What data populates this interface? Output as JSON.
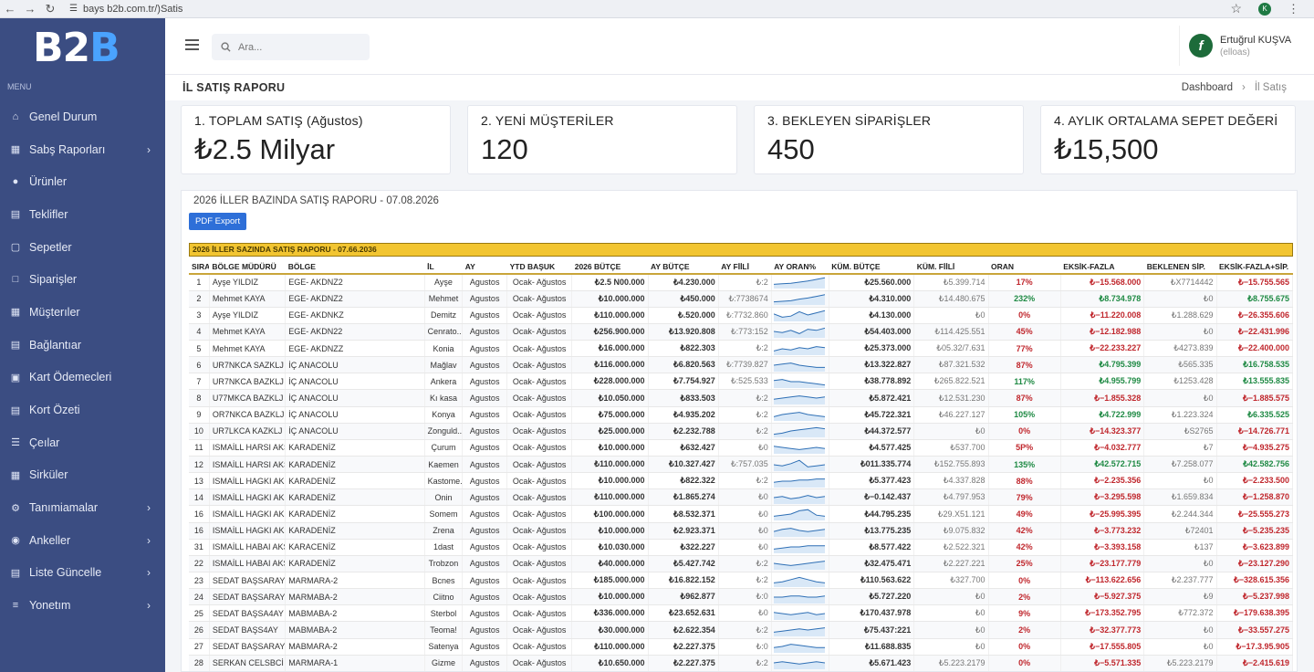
{
  "browser": {
    "url": "bays b2b.com.tr/)Satis"
  },
  "sidebar": {
    "logo_a": "B2",
    "logo_b": "B",
    "menu_label": "MENU",
    "items": [
      {
        "label": "Genel Durum",
        "icon": "home-icon",
        "chevron": false
      },
      {
        "label": "Sabş Raporları",
        "icon": "chart-icon",
        "chevron": true
      },
      {
        "label": "Ürünler",
        "icon": "box-icon",
        "chevron": false
      },
      {
        "label": "Teklifler",
        "icon": "document-icon",
        "chevron": false
      },
      {
        "label": "Sepetler",
        "icon": "cart-icon",
        "chevron": false
      },
      {
        "label": "Siparişler",
        "icon": "order-icon",
        "chevron": false
      },
      {
        "label": "Müşterıler",
        "icon": "users-icon",
        "chevron": false
      },
      {
        "label": "Bağlantıar",
        "icon": "link-icon",
        "chevron": false
      },
      {
        "label": "Kart Ödemecleri",
        "icon": "card-icon",
        "chevron": false
      },
      {
        "label": "Kort Özeti",
        "icon": "summary-icon",
        "chevron": false
      },
      {
        "label": "Çeılar",
        "icon": "cheque-icon",
        "chevron": false
      },
      {
        "label": "Sirküler",
        "icon": "circular-icon",
        "chevron": false
      },
      {
        "label": "Tanımiamalar",
        "icon": "settings-icon",
        "chevron": true
      },
      {
        "label": "Ankeller",
        "icon": "survey-icon",
        "chevron": true
      },
      {
        "label": "Liste Güncelle",
        "icon": "list-icon",
        "chevron": true
      },
      {
        "label": "Yonetım",
        "icon": "admin-icon",
        "chevron": true
      }
    ]
  },
  "header": {
    "search_placeholder": "Ara...",
    "user_initial": "f",
    "user_name": "Ertuğrul KUŞVA",
    "user_role": "(elloas)"
  },
  "page": {
    "title": "İL SATIŞ RAPORU",
    "breadcrumb_home": "Dashboard",
    "breadcrumb_sep": "›",
    "breadcrumb_current": "İl Satış"
  },
  "cards": [
    {
      "label": "1. TOPLAM SATIŞ (Ağustos)",
      "value": "₺2.5 Milyar"
    },
    {
      "label": "2. YENİ MÜŞTERİLER",
      "value": "120"
    },
    {
      "label": "3. BEKLEYEN SİPARİŞLER",
      "value": "450"
    },
    {
      "label": "4. AYLIK ORTALAMA SEPET DEĞERİ",
      "value": "₺15,500"
    }
  ],
  "report": {
    "title": "2026 İLLER BAZINDA SATIŞ RAPORU - 07.08.2026",
    "pdf_button": "PDF Export",
    "banner": "2026 İLLER SAZINDA SATIŞ RAPORU - 07.66.2036",
    "columns": [
      "SIRA",
      "BÖLGE MÜDÜRÜ",
      "BÖLGE",
      "İL",
      "AY",
      "YTD BAŞUK",
      "2026 BÜTÇE",
      "AY BÜTÇE",
      "AY FİİLİ",
      "AY ORAN%",
      "KÜM. BÜTÇE",
      "KÜM. FİİLİ",
      "ORAN",
      "EKSİK-FAZLA",
      "BEKLENEN SİP.",
      "EKSİK-FAZLA+SİP."
    ],
    "rows": [
      {
        "sira": "1",
        "mudur": "Ayşe YILDIZ",
        "bolge": "EGE- AKDNZ2",
        "il": "Ayşe",
        "ay": "Agustos",
        "ytd": "Ocak- Ağustos",
        "butce": "₺2.5 N00.000",
        "ay_butce": "₺4.230.000",
        "ay_fiili": "₺:2",
        "trend": [
          0.3,
          0.35,
          0.4,
          0.5,
          0.6,
          0.75,
          0.9
        ],
        "kum_butce": "₺25.560.000",
        "kum_fiili": "₺5.399.714",
        "oran": "17%",
        "oran_pos": false,
        "eksik": "₺−15.568.000",
        "eksik_pos": false,
        "beklenen": "₺X7714442",
        "son": "₺−15.755.565",
        "son_pos": false
      },
      {
        "sira": "2",
        "mudur": "Mehmet KAYA",
        "bolge": "EGE- AKDNZ2",
        "il": "Mehmet",
        "ay": "Agustos",
        "ytd": "Ocak- Ağustos",
        "butce": "₺10.000.000",
        "ay_butce": "₺450.000",
        "ay_fiili": "₺:7738674",
        "trend": [
          0.2,
          0.25,
          0.3,
          0.45,
          0.55,
          0.7,
          0.85
        ],
        "kum_butce": "₺4.310.000",
        "kum_fiili": "₺14.480.675",
        "oran": "232%",
        "oran_pos": true,
        "eksik": "₺8.734.978",
        "eksik_pos": true,
        "beklenen": "₺0",
        "son": "₺8.755.675",
        "son_pos": true
      },
      {
        "sira": "3",
        "mudur": "Ayşe YILDIZ",
        "bolge": "EGE- AKDNKZ",
        "il": "Demitz",
        "ay": "Agustos",
        "ytd": "Ocak- Ağustos",
        "butce": "₺110.000.000",
        "ay_butce": "₺.520.000",
        "ay_fiili": "₺:7732.860",
        "trend": [
          0.6,
          0.3,
          0.4,
          0.8,
          0.5,
          0.7,
          0.9
        ],
        "kum_butce": "₺4.130.000",
        "kum_fiili": "₺0",
        "oran": "0%",
        "oran_pos": false,
        "eksik": "₺−11.220.008",
        "eksik_pos": false,
        "beklenen": "₺1.288.629",
        "son": "₺−26.355.606",
        "son_pos": false
      },
      {
        "sira": "4",
        "mudur": "Mehmet KAYA",
        "bolge": "EGE- AKDN22",
        "il": "Cenrato...",
        "ay": "Agustos",
        "ytd": "Ocak- Ağustos",
        "butce": "₺256.900.000",
        "ay_butce": "₺13.920.808",
        "ay_fiili": "₺:773:152",
        "trend": [
          0.5,
          0.4,
          0.6,
          0.3,
          0.7,
          0.6,
          0.8
        ],
        "kum_butce": "₺54.403.000",
        "kum_fiili": "₺114.425.551",
        "oran": "45%",
        "oran_pos": false,
        "eksik": "₺−12.182.988",
        "eksik_pos": false,
        "beklenen": "₺0",
        "son": "₺−22.431.996",
        "son_pos": false
      },
      {
        "sira": "5",
        "mudur": "Mehmet KAYA",
        "bolge": "EGE- AKDNZZ",
        "il": "Konia",
        "ay": "Agustos",
        "ytd": "Ocak- Ağustos",
        "butce": "₺16.000.000",
        "ay_butce": "₺822.303",
        "ay_fiili": "₺:2",
        "trend": [
          0.3,
          0.5,
          0.4,
          0.6,
          0.5,
          0.7,
          0.6
        ],
        "kum_butce": "₺25.373.000",
        "kum_fiili": "₺05.32/7.631",
        "oran": "77%",
        "oran_pos": false,
        "eksik": "₺−22.233.227",
        "eksik_pos": false,
        "beklenen": "₺4273.839",
        "son": "₺−22.400.000",
        "son_pos": false
      },
      {
        "sira": "6",
        "mudur": "UR7NKCA SAZKLJ",
        "bolge": "İÇ ANACOLU",
        "il": "Mağlav",
        "ay": "Agustos",
        "ytd": "Ocak- Ağustos",
        "butce": "₺116.000.000",
        "ay_butce": "₺6.820.563",
        "ay_fiili": "₺:7739.827",
        "trend": [
          0.5,
          0.6,
          0.7,
          0.5,
          0.4,
          0.3,
          0.3
        ],
        "kum_butce": "₺13.322.827",
        "kum_fiili": "₺87.321.532",
        "oran": "87%",
        "oran_pos": false,
        "eksik": "₺4.795.399",
        "eksik_pos": true,
        "beklenen": "₺565.335",
        "son": "₺16.758.535",
        "son_pos": true
      },
      {
        "sira": "7",
        "mudur": "UR7NKCA BAZKLJ",
        "bolge": "İÇ ANACOLU",
        "il": "Ankera",
        "ay": "Agustos",
        "ytd": "Ocak- Ağustos",
        "butce": "₺228.000.000",
        "ay_butce": "₺7.754.927",
        "ay_fiili": "₺:525.533",
        "trend": [
          0.6,
          0.7,
          0.5,
          0.5,
          0.4,
          0.3,
          0.2
        ],
        "kum_butce": "₺38.778.892",
        "kum_fiili": "₺265.822.521",
        "oran": "117%",
        "oran_pos": true,
        "eksik": "₺4.955.799",
        "eksik_pos": true,
        "beklenen": "₺1253.428",
        "son": "₺13.555.835",
        "son_pos": true
      },
      {
        "sira": "8",
        "mudur": "U77MKCA BAZKLJ",
        "bolge": "İÇ ANACOLU",
        "il": "Kı kasa",
        "ay": "Agustos",
        "ytd": "Ocak- Ağustos",
        "butce": "₺10.050.000",
        "ay_butce": "₺833.503",
        "ay_fiili": "₺:2",
        "trend": [
          0.4,
          0.5,
          0.6,
          0.7,
          0.6,
          0.5,
          0.6
        ],
        "kum_butce": "₺5.872.421",
        "kum_fiili": "₺12.531.230",
        "oran": "87%",
        "oran_pos": false,
        "eksik": "₺−1.855.328",
        "eksik_pos": false,
        "beklenen": "₺0",
        "son": "₺−1.885.575",
        "son_pos": false
      },
      {
        "sira": "9",
        "mudur": "OR7NKCA BAZKLJ",
        "bolge": "İÇ ANACOLU",
        "il": "Konya",
        "ay": "Agustos",
        "ytd": "Ocak- Ağustos",
        "butce": "₺75.000.000",
        "ay_butce": "₺4.935.202",
        "ay_fiili": "₺:2",
        "trend": [
          0.3,
          0.5,
          0.6,
          0.7,
          0.5,
          0.4,
          0.3
        ],
        "kum_butce": "₺45.722.321",
        "kum_fiili": "₺46.227.127",
        "oran": "105%",
        "oran_pos": true,
        "eksik": "₺4.722.999",
        "eksik_pos": true,
        "beklenen": "₺1.223.324",
        "son": "₺6.335.525",
        "son_pos": true
      },
      {
        "sira": "10",
        "mudur": "UR7LKCA KAZKLJ",
        "bolge": "İÇ ANACOLU",
        "il": "Zonguld...",
        "ay": "Agustos",
        "ytd": "Ocak- Ağustos",
        "butce": "₺25.000.000",
        "ay_butce": "₺2.232.788",
        "ay_fiili": "₺:2",
        "trend": [
          0.2,
          0.3,
          0.5,
          0.6,
          0.7,
          0.8,
          0.7
        ],
        "kum_butce": "₺44.372.577",
        "kum_fiili": "₺0",
        "oran": "0%",
        "oran_pos": false,
        "eksik": "₺−14.323.377",
        "eksik_pos": false,
        "beklenen": "₺S2765",
        "son": "₺−14.726.771",
        "son_pos": false
      },
      {
        "sira": "11",
        "mudur": "ISMAİLL HARSI AKS.",
        "bolge": "KARADENİZ",
        "il": "Çurum",
        "ay": "Agustos",
        "ytd": "Ocak- Ağustos",
        "butce": "₺10.000.000",
        "ay_butce": "₺632.427",
        "ay_fiili": "₺0",
        "trend": [
          0.6,
          0.5,
          0.4,
          0.3,
          0.4,
          0.5,
          0.4
        ],
        "kum_butce": "₺4.577.425",
        "kum_fiili": "₺537.700",
        "oran": "5P%",
        "oran_pos": false,
        "eksik": "₺−4.032.777",
        "eksik_pos": false,
        "beklenen": "₺7",
        "son": "₺−4.935.275",
        "son_pos": false
      },
      {
        "sira": "12",
        "mudur": "ISMAİLL HARSI AKS.",
        "bolge": "KARADENİZ",
        "il": "Kaemen",
        "ay": "Agustos",
        "ytd": "Ocak- Ağustos",
        "butce": "₺110.000.000",
        "ay_butce": "₺10.327.427",
        "ay_fiili": "₺:757.035",
        "trend": [
          0.5,
          0.4,
          0.6,
          0.9,
          0.3,
          0.4,
          0.5
        ],
        "kum_butce": "₺011.335.774",
        "kum_fiili": "₺152.755.893",
        "oran": "135%",
        "oran_pos": true,
        "eksik": "₺42.572.715",
        "eksik_pos": true,
        "beklenen": "₺7.258.077",
        "son": "₺42.582.756",
        "son_pos": true
      },
      {
        "sira": "13",
        "mudur": "ISMAİLL HAGKI AKS.",
        "bolge": "KARADENİZ",
        "il": "Kastome...",
        "ay": "Agustos",
        "ytd": "Ocak- Ağustos",
        "butce": "₺10.000.000",
        "ay_butce": "₺822.322",
        "ay_fiili": "₺:2",
        "trend": [
          0.4,
          0.5,
          0.5,
          0.6,
          0.6,
          0.7,
          0.7
        ],
        "kum_butce": "₺5.377.423",
        "kum_fiili": "₺4.337.828",
        "oran": "88%",
        "oran_pos": false,
        "eksik": "₺−2.235.356",
        "eksik_pos": false,
        "beklenen": "₺0",
        "son": "₺−2.233.500",
        "son_pos": false
      },
      {
        "sira": "14",
        "mudur": "ISMAİLL HAGKI AKS.",
        "bolge": "KARADENİZ",
        "il": "Onin",
        "ay": "Agustos",
        "ytd": "Ocak- Ağustos",
        "butce": "₺110.000.000",
        "ay_butce": "₺1.865.274",
        "ay_fiili": "₺0",
        "trend": [
          0.5,
          0.6,
          0.4,
          0.5,
          0.7,
          0.5,
          0.6
        ],
        "kum_butce": "₺−0.142.437",
        "kum_fiili": "₺4.797.953",
        "oran": "79%",
        "oran_pos": false,
        "eksik": "₺−3.295.598",
        "eksik_pos": false,
        "beklenen": "₺1.659.834",
        "son": "₺−1.258.870",
        "son_pos": false
      },
      {
        "sira": "16",
        "mudur": "ISMAİLL HAGKI AKS.",
        "bolge": "KARADENİZ",
        "il": "Somem",
        "ay": "Agustos",
        "ytd": "Ocak- Ağustos",
        "butce": "₺100.000.000",
        "ay_butce": "₺8.532.371",
        "ay_fiili": "₺0",
        "trend": [
          0.3,
          0.4,
          0.5,
          0.8,
          0.9,
          0.4,
          0.3
        ],
        "kum_butce": "₺44.795.235",
        "kum_fiili": "₺29.X51.121",
        "oran": "49%",
        "oran_pos": false,
        "eksik": "₺−25.995.395",
        "eksik_pos": false,
        "beklenen": "₺2.244.344",
        "son": "₺−25.555.273",
        "son_pos": false
      },
      {
        "sira": "16",
        "mudur": "ISMAİLL HAGKI AKS.",
        "bolge": "KARADENİZ",
        "il": "Zrena",
        "ay": "Agustos",
        "ytd": "Ocak- Ağustos",
        "butce": "₺10.000.000",
        "ay_butce": "₺2.923.371",
        "ay_fiili": "₺0",
        "trend": [
          0.4,
          0.6,
          0.7,
          0.5,
          0.4,
          0.5,
          0.6
        ],
        "kum_butce": "₺13.775.235",
        "kum_fiili": "₺9.075.832",
        "oran": "42%",
        "oran_pos": false,
        "eksik": "₺−3.773.232",
        "eksik_pos": false,
        "beklenen": "₺72401",
        "son": "₺−5.235.235",
        "son_pos": false
      },
      {
        "sira": "31",
        "mudur": "ISMAİLL HABAI AKS.",
        "bolge": "KARACENİZ",
        "il": "1dast",
        "ay": "Agustos",
        "ytd": "Ocak- Ağustos",
        "butce": "₺10.030.000",
        "ay_butce": "₺322.227",
        "ay_fiili": "₺0",
        "trend": [
          0.3,
          0.4,
          0.5,
          0.5,
          0.6,
          0.6,
          0.6
        ],
        "kum_butce": "₺8.577.422",
        "kum_fiili": "₺2.522.321",
        "oran": "42%",
        "oran_pos": false,
        "eksik": "₺−3.393.158",
        "eksik_pos": false,
        "beklenen": "₺137",
        "son": "₺−3.623.899",
        "son_pos": false
      },
      {
        "sira": "22",
        "mudur": "ISMAİLL HABAI AKS.",
        "bolge": "KARADENİZ",
        "il": "Trobzon",
        "ay": "Agustos",
        "ytd": "Ocak- Ağustos",
        "butce": "₺40.000.000",
        "ay_butce": "₺5.427.742",
        "ay_fiili": "₺:2",
        "trend": [
          0.5,
          0.4,
          0.3,
          0.4,
          0.5,
          0.6,
          0.7
        ],
        "kum_butce": "₺32.475.471",
        "kum_fiili": "₺2.227.221",
        "oran": "25%",
        "oran_pos": false,
        "eksik": "₺−23.177.779",
        "eksik_pos": false,
        "beklenen": "₺0",
        "son": "₺−23.127.290",
        "son_pos": false
      },
      {
        "sira": "23",
        "mudur": "SEDAT BAŞSARAY",
        "bolge": "MARMARA-2",
        "il": "Bcnes",
        "ay": "Agustos",
        "ytd": "Ocak- Ağustos",
        "butce": "₺185.000.000",
        "ay_butce": "₺16.822.152",
        "ay_fiili": "₺:2",
        "trend": [
          0.3,
          0.4,
          0.6,
          0.8,
          0.6,
          0.4,
          0.3
        ],
        "kum_butce": "₺110.563.622",
        "kum_fiili": "₺327.700",
        "oran": "0%",
        "oran_pos": false,
        "eksik": "₺−113.622.656",
        "eksik_pos": false,
        "beklenen": "₺2.237.777",
        "son": "₺−328.615.356",
        "son_pos": false
      },
      {
        "sira": "24",
        "mudur": "SEDAT BAŞSARAY",
        "bolge": "MARMABA-2",
        "il": "Ciitno",
        "ay": "Agustos",
        "ytd": "Ocak- Ağustos",
        "butce": "₺10.000.000",
        "ay_butce": "₺962.877",
        "ay_fiili": "₺:0",
        "trend": [
          0.5,
          0.5,
          0.6,
          0.6,
          0.5,
          0.5,
          0.6
        ],
        "kum_butce": "₺5.727.220",
        "kum_fiili": "₺0",
        "oran": "2%",
        "oran_pos": false,
        "eksik": "₺−5.927.375",
        "eksik_pos": false,
        "beklenen": "₺9",
        "son": "₺−5.237.998",
        "son_pos": false
      },
      {
        "sira": "25",
        "mudur": "SEDAT BAŞSA4AY",
        "bolge": "MABMABA-2",
        "il": "Sterbol",
        "ay": "Agustos",
        "ytd": "Ocak- Ağustos",
        "butce": "₺336.000.000",
        "ay_butce": "₺23.652.631",
        "ay_fiili": "₺0",
        "trend": [
          0.6,
          0.5,
          0.4,
          0.5,
          0.6,
          0.4,
          0.5
        ],
        "kum_butce": "₺170.437.978",
        "kum_fiili": "₺0",
        "oran": "9%",
        "oran_pos": false,
        "eksik": "₺−173.352.795",
        "eksik_pos": false,
        "beklenen": "₺772.372",
        "son": "₺−179.638.395",
        "son_pos": false
      },
      {
        "sira": "26",
        "mudur": "SEDAT BAŞS4AY",
        "bolge": "MABMABA-2",
        "il": "Teoma!",
        "ay": "Agustos",
        "ytd": "Ocak- Ağustos",
        "butce": "₺30.000.000",
        "ay_butce": "₺2.622.354",
        "ay_fiili": "₺:2",
        "trend": [
          0.3,
          0.4,
          0.5,
          0.6,
          0.5,
          0.6,
          0.7
        ],
        "kum_butce": "₺75.437:221",
        "kum_fiili": "₺0",
        "oran": "2%",
        "oran_pos": false,
        "eksik": "₺−32.377.773",
        "eksik_pos": false,
        "beklenen": "₺0",
        "son": "₺−33.557.275",
        "son_pos": false
      },
      {
        "sira": "27",
        "mudur": "SEDAT BAŞSARAY",
        "bolge": "MABMARA-2",
        "il": "Satenya",
        "ay": "Agustos",
        "ytd": "Ocak- Ağustos",
        "butce": "₺110.000.000",
        "ay_butce": "₺2.227.375",
        "ay_fiili": "₺:0",
        "trend": [
          0.4,
          0.5,
          0.7,
          0.6,
          0.5,
          0.4,
          0.4
        ],
        "kum_butce": "₺11.688.835",
        "kum_fiili": "₺0",
        "oran": "0%",
        "oran_pos": false,
        "eksik": "₺−17.555.805",
        "eksik_pos": false,
        "beklenen": "₺0",
        "son": "₺−17.3.95.905",
        "son_pos": false
      },
      {
        "sira": "28",
        "mudur": "SERKAN CELSBCİ",
        "bolge": "MARMARA-1",
        "il": "Gizme",
        "ay": "Agustos",
        "ytd": "Ocak- Ağustos",
        "butce": "₺10.650.000",
        "ay_butce": "₺2.227.375",
        "ay_fiili": "₺:2",
        "trend": [
          0.5,
          0.6,
          0.5,
          0.4,
          0.5,
          0.6,
          0.5
        ],
        "kum_butce": "₺5.671.423",
        "kum_fiili": "₺5.223.2179",
        "oran": "0%",
        "oran_pos": false,
        "eksik": "₺−5.571.335",
        "eksik_pos": false,
        "beklenen": "₺5.223.2179",
        "son": "₺−2.415.619",
        "son_pos": false
      }
    ]
  },
  "colors": {
    "sidebar": "#3b4d82",
    "accent": "#2e6fd8",
    "banner": "#f2c531",
    "negative": "#c0272d",
    "positive": "#1f8a44"
  }
}
